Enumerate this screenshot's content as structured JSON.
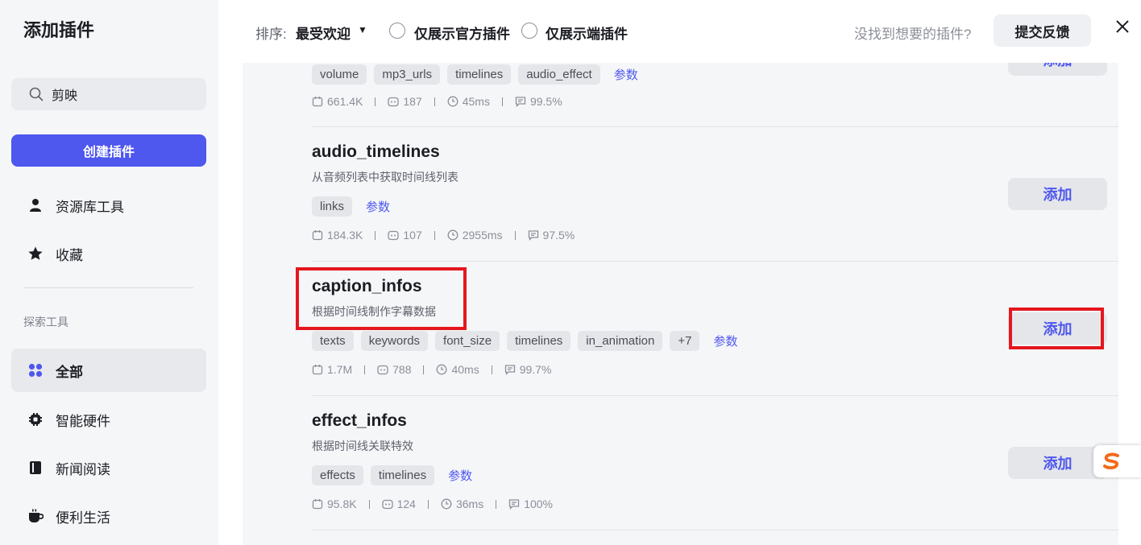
{
  "sidebar": {
    "title": "添加插件",
    "search_value": "剪映",
    "create_label": "创建插件",
    "nav": [
      {
        "label": "资源库工具",
        "icon": "user-icon"
      },
      {
        "label": "收藏",
        "icon": "star-icon"
      }
    ],
    "section_label": "探索工具",
    "categories": [
      {
        "label": "全部",
        "icon": "grid-icon",
        "active": true
      },
      {
        "label": "智能硬件",
        "icon": "chip-icon"
      },
      {
        "label": "新闻阅读",
        "icon": "book-icon"
      },
      {
        "label": "便利生活",
        "icon": "cup-icon"
      }
    ]
  },
  "header": {
    "sort_label": "排序:",
    "sort_value": "最受欢迎",
    "filter_official": "仅展示官方插件",
    "filter_client": "仅展示端插件",
    "hint": "没找到想要的插件?",
    "feedback_label": "提交反馈"
  },
  "plugins": [
    {
      "title": "",
      "description": "",
      "tags": [
        "volume",
        "mp3_urls",
        "timelines",
        "audio_effect"
      ],
      "params_label": "参数",
      "stats": {
        "uses": "661.4K",
        "bots": "187",
        "latency": "45ms",
        "success": "99.5%"
      },
      "add_label": "添加"
    },
    {
      "title": "audio_timelines",
      "description": "从音频列表中获取时间线列表",
      "tags": [
        "links"
      ],
      "params_label": "参数",
      "stats": {
        "uses": "184.3K",
        "bots": "107",
        "latency": "2955ms",
        "success": "97.5%"
      },
      "add_label": "添加"
    },
    {
      "title": "caption_infos",
      "description": "根据时间线制作字幕数据",
      "tags": [
        "texts",
        "keywords",
        "font_size",
        "timelines",
        "in_animation",
        "+7"
      ],
      "params_label": "参数",
      "stats": {
        "uses": "1.7M",
        "bots": "788",
        "latency": "40ms",
        "success": "99.7%"
      },
      "add_label": "添加"
    },
    {
      "title": "effect_infos",
      "description": "根据时间线关联特效",
      "tags": [
        "effects",
        "timelines"
      ],
      "params_label": "参数",
      "stats": {
        "uses": "95.8K",
        "bots": "124",
        "latency": "36ms",
        "success": "100%"
      },
      "add_label": "添加"
    }
  ],
  "colors": {
    "accent": "#4e57ee",
    "highlight": "#e5161e"
  }
}
